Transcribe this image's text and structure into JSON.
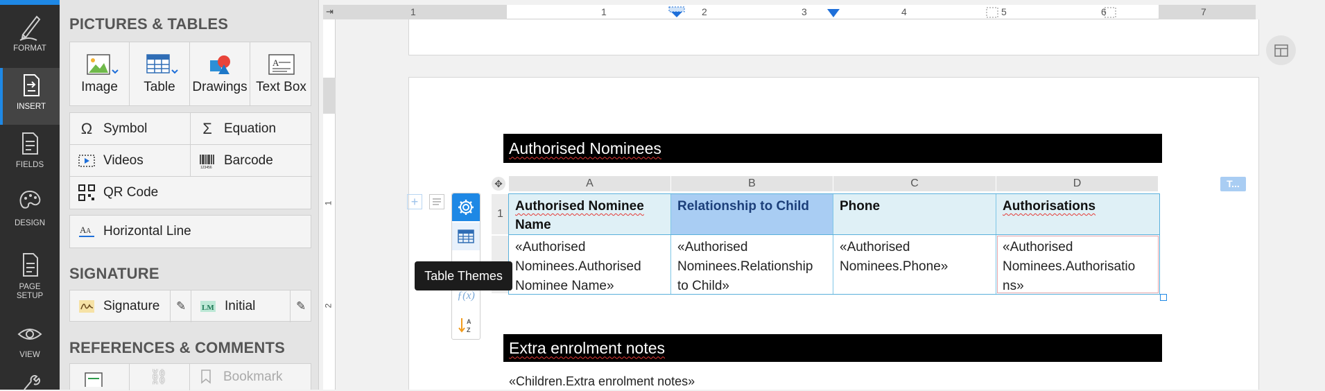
{
  "rail": {
    "items": [
      {
        "label": "FORMAT",
        "icon": "pen-icon"
      },
      {
        "label": "INSERT",
        "icon": "insert-icon"
      },
      {
        "label": "FIELDS",
        "icon": "fields-icon"
      },
      {
        "label": "DESIGN",
        "icon": "palette-icon"
      },
      {
        "label_line1": "PAGE",
        "label_line2": "SETUP",
        "icon": "page-setup-icon"
      },
      {
        "label": "VIEW",
        "icon": "eye-icon"
      }
    ]
  },
  "panel": {
    "pictures_title": "PICTURES & TABLES",
    "big_buttons": [
      "Image",
      "Table",
      "Drawings",
      "Text Box"
    ],
    "rows": {
      "symbol": "Symbol",
      "equation": "Equation",
      "videos": "Videos",
      "barcode": "Barcode",
      "qr": "QR Code",
      "hline": "Horizontal Line"
    },
    "signature_title": "SIGNATURE",
    "signature": "Signature",
    "initial": "Initial",
    "references_title": "REFERENCES & COMMENTS",
    "bookmark": "Bookmark"
  },
  "ruler": {
    "numbers": [
      "1",
      "1",
      "2",
      "3",
      "4",
      "5",
      "6",
      "7"
    ],
    "left_numbers": [
      "1",
      "2"
    ]
  },
  "doc": {
    "heading1": "Authorised Nominees",
    "columns": [
      "A",
      "B",
      "C",
      "D"
    ],
    "row_number": "1",
    "header": {
      "a_line1": "Authorised Nominee",
      "a_line2": "Name",
      "b": "Relationship to Child",
      "c": "Phone",
      "d": "Authorisations"
    },
    "body": {
      "a": [
        "«Authorised",
        "Nominees.Authorised",
        "Nominee Name»"
      ],
      "b": [
        "«Authorised",
        "Nominees.Relationship",
        "to Child»"
      ],
      "c": [
        "«Authorised",
        "Nominees.Phone»"
      ],
      "d": [
        "«Authorised",
        "Nominees.Authorisatio",
        "ns»"
      ]
    },
    "heading2": "Extra enrolment notes",
    "notes": "«Children.Extra enrolment notes»",
    "tag": "T..."
  },
  "tooltip": "Table Themes",
  "colors": {
    "accent": "#1e88e5",
    "rail": "#2e2e2e",
    "selected_cell": "#a9cdf3",
    "header_cell": "#dff0f6"
  }
}
